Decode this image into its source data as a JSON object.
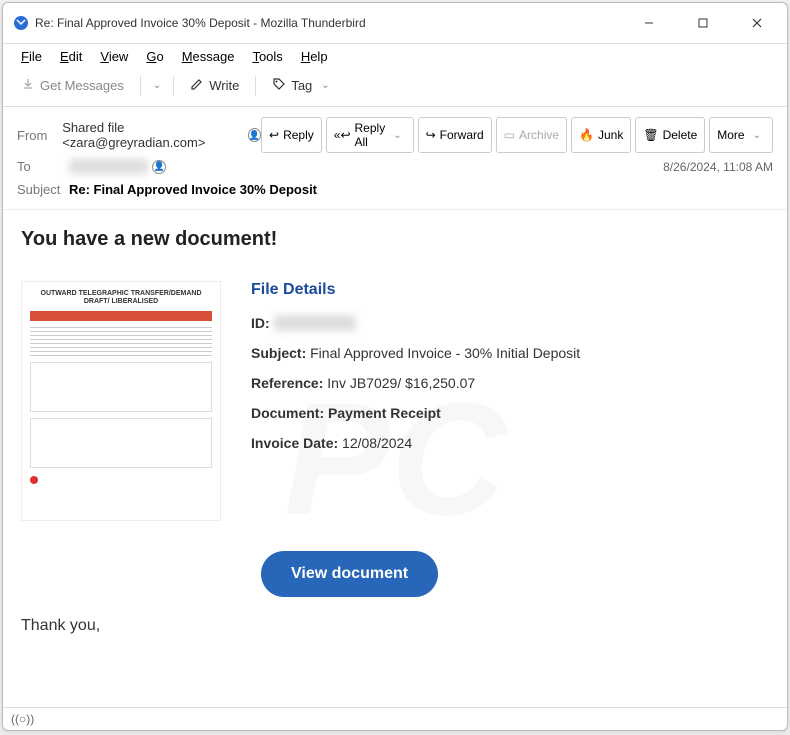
{
  "window": {
    "title": "Re: Final Approved Invoice 30% Deposit - Mozilla Thunderbird"
  },
  "menu": {
    "file": "File",
    "edit": "Edit",
    "view": "View",
    "go": "Go",
    "message": "Message",
    "tools": "Tools",
    "help": "Help"
  },
  "toolbar": {
    "get_messages": "Get Messages",
    "write": "Write",
    "tag": "Tag"
  },
  "header": {
    "from_label": "From",
    "from_value": "Shared file <zara@greyradian.com>",
    "to_label": "To",
    "subject_label": "Subject",
    "subject_value": "Re: Final Approved Invoice 30% Deposit",
    "date": "8/26/2024, 11:08 AM"
  },
  "actions": {
    "reply": "Reply",
    "reply_all": "Reply All",
    "forward": "Forward",
    "archive": "Archive",
    "junk": "Junk",
    "delete": "Delete",
    "more": "More"
  },
  "body": {
    "headline": "You have a new document!",
    "thumb_title": "OUTWARD TELEGRAPHIC TRANSFER/DEMAND DRAFT/ LIBERALISED",
    "details_title": "File Details",
    "id_label": "ID:",
    "subject_label": "Subject:",
    "subject_value": " Final Approved Invoice - 30% Initial Deposit",
    "reference_label": "Reference:",
    "reference_value": " Inv JB7029/ $16,250.07",
    "document_label": "Document: Payment Receipt",
    "invoice_date_label": "Invoice Date:",
    "invoice_date_value": " 12/08/2024",
    "view_button": "View document",
    "thankyou": "Thank you,"
  },
  "status": {
    "indicator": "((○))"
  }
}
